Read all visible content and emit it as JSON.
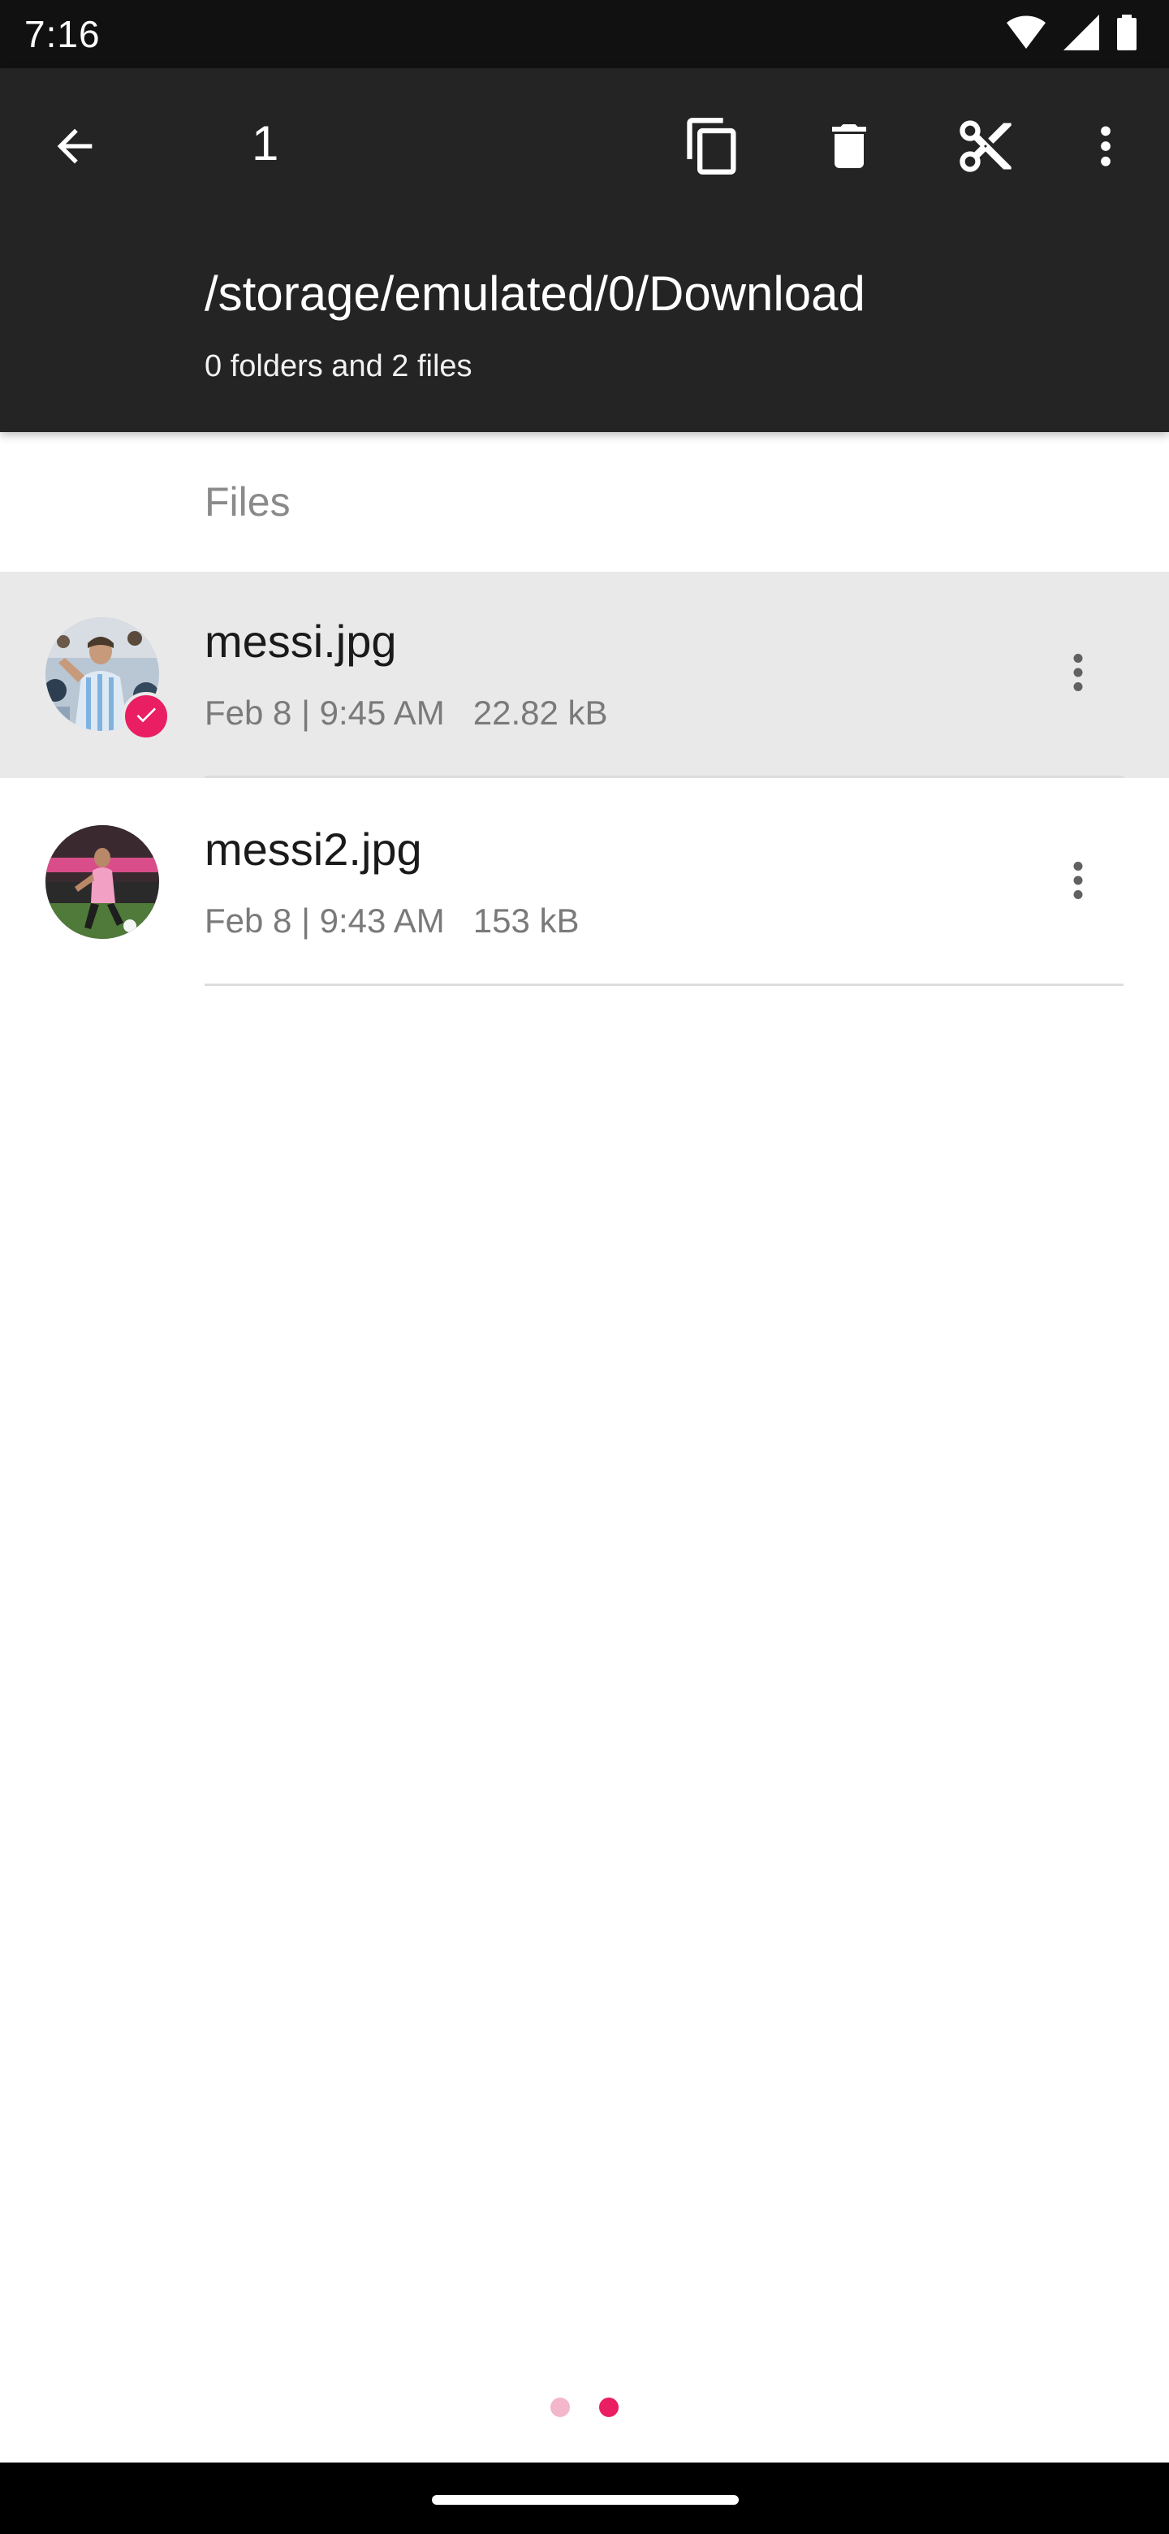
{
  "status_bar": {
    "time": "7:16",
    "icons": [
      "wifi-icon",
      "signal-icon",
      "battery-icon"
    ]
  },
  "toolbar": {
    "back_icon": "arrow-back-icon",
    "selected_count": "1",
    "actions": [
      "copy-icon",
      "delete-icon",
      "cut-icon",
      "more-vert-icon"
    ]
  },
  "location": {
    "path": "/storage/emulated/0/Download",
    "summary": "0 folders and 2 files"
  },
  "section": {
    "title": "Files"
  },
  "files": [
    {
      "name": "messi.jpg",
      "meta": "Feb 8 | 9:45 AM   22.82 kB",
      "selected": true
    },
    {
      "name": "messi2.jpg",
      "meta": "Feb 8 | 9:43 AM   153 kB",
      "selected": false
    }
  ],
  "pager": {
    "pages": 2,
    "current": 2
  },
  "colors": {
    "accent": "#e91e63",
    "accent_light": "#f4b6cb",
    "toolbar_bg": "#242424",
    "selected_row_bg": "#e9e9e9"
  }
}
